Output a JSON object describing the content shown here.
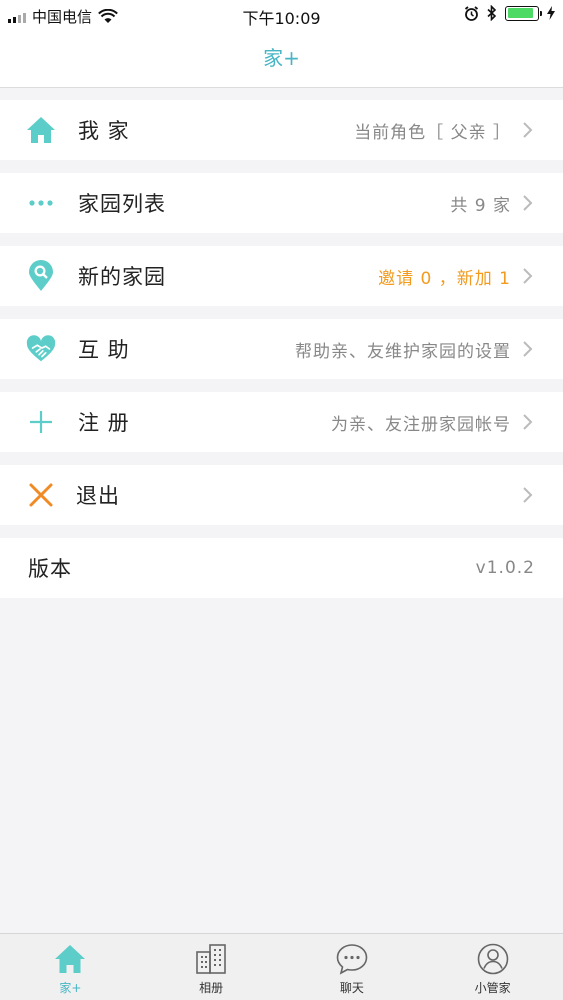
{
  "status_bar": {
    "carrier": "中国电信",
    "time": "下午10:09",
    "battery_level": 0.9
  },
  "nav": {
    "title": "家+"
  },
  "menu": [
    {
      "label": "我 家",
      "value": "当前角色［ 父亲 ］",
      "icon": "home-icon"
    },
    {
      "label": "家园列表",
      "value": "共 9 家",
      "icon": "more-dots-icon"
    },
    {
      "label": "新的家园",
      "value": "邀请 0 ，新加  1",
      "icon": "location-search-icon",
      "value_color": "#f29b1e"
    },
    {
      "label": "互 助",
      "value": "帮助亲、友维护家园的设置",
      "icon": "handshake-heart-icon"
    },
    {
      "label": "注 册",
      "value": "为亲、友注册家园帐号",
      "icon": "plus-icon"
    },
    {
      "label": "退出",
      "value": "",
      "icon": "close-x-icon"
    }
  ],
  "version": {
    "label": "版本",
    "value": "v1.0.2"
  },
  "tabs": [
    {
      "label": "家+",
      "icon": "home-icon",
      "active": true
    },
    {
      "label": "相册",
      "icon": "buildings-icon",
      "active": false
    },
    {
      "label": "聊天",
      "icon": "chat-bubble-icon",
      "active": false
    },
    {
      "label": "小管家",
      "icon": "user-circle-icon",
      "active": false
    }
  ],
  "colors": {
    "accent": "#47b5c4",
    "icon_teal": "#5ccdc8",
    "orange": "#f29b1e",
    "exit_orange": "#f08a24"
  }
}
